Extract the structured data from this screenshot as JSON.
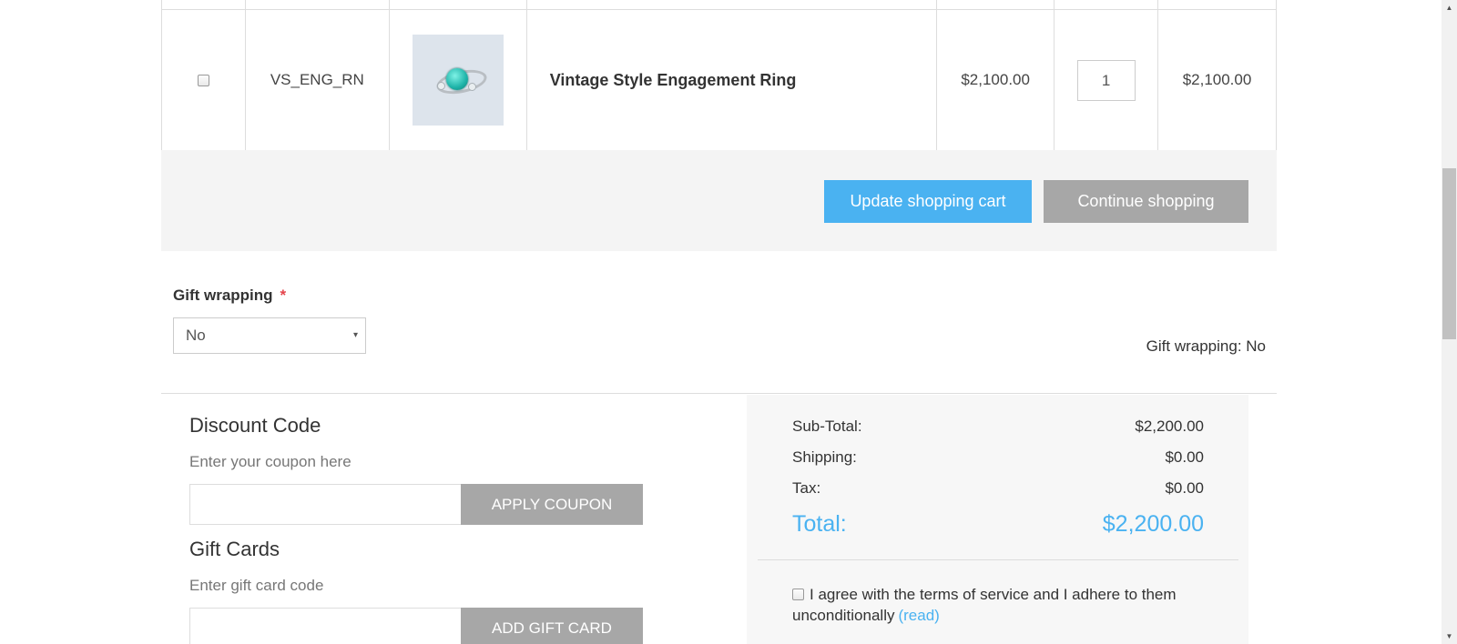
{
  "cart": {
    "item": {
      "sku": "VS_ENG_RN",
      "name": "Vintage Style Engagement Ring",
      "price": "$2,100.00",
      "quantity": "1",
      "total": "$2,100.00",
      "image_icon": "engagement-ring-icon"
    },
    "update_label": "Update shopping cart",
    "continue_label": "Continue shopping"
  },
  "gift_wrapping": {
    "label": "Gift wrapping",
    "required_mark": "*",
    "selected": "No",
    "caret": "▾",
    "summary": "Gift wrapping: No"
  },
  "discount": {
    "title": "Discount Code",
    "hint": "Enter your coupon here",
    "value": "",
    "button_label": "APPLY COUPON"
  },
  "gift_cards": {
    "title": "Gift Cards",
    "hint": "Enter gift card code",
    "value": "",
    "button_label": "ADD GIFT CARD"
  },
  "totals": {
    "subtotal_label": "Sub-Total:",
    "subtotal_value": "$2,200.00",
    "shipping_label": "Shipping:",
    "shipping_value": "$0.00",
    "tax_label": "Tax:",
    "tax_value": "$0.00",
    "total_label": "Total:",
    "total_value": "$2,200.00",
    "terms_text": "I agree with the terms of service and I adhere to them unconditionally",
    "terms_link": "(read)"
  },
  "scrollbar": {
    "up": "▲",
    "down": "▼"
  },
  "colors": {
    "accent": "#4ab2f1",
    "secondary_button": "#a7a7a7",
    "required": "#e4434b"
  }
}
